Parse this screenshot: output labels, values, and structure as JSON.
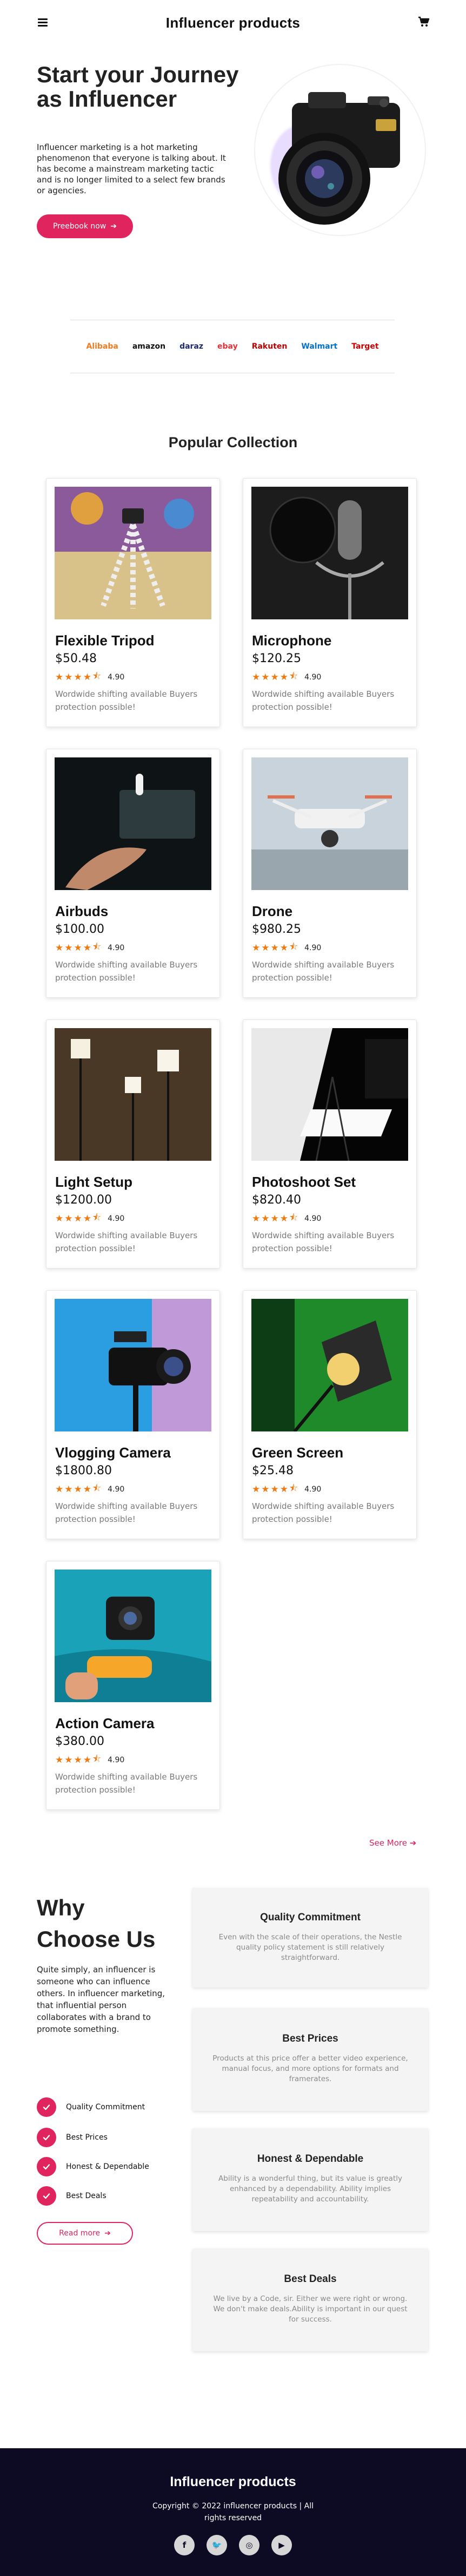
{
  "header": {
    "title": "Influencer products"
  },
  "hero": {
    "title": "Start your Journey as Influencer",
    "text": "Influencer marketing is a hot marketing phenomenon that everyone is talking about. It has become a mainstream marketing tactic and is no longer limited to a select few brands or agencies.",
    "button_label": "Preebook now"
  },
  "brands": [
    {
      "name": "Alibaba",
      "color": "#f47a20"
    },
    {
      "name": "amazon",
      "color": "#111111"
    },
    {
      "name": "daraz",
      "color": "#1a2a6c"
    },
    {
      "name": "ebay",
      "color": "#e53238"
    },
    {
      "name": "Rakuten",
      "color": "#bf0000"
    },
    {
      "name": "Walmart",
      "color": "#0071ce"
    },
    {
      "name": "Target",
      "color": "#cc0000"
    }
  ],
  "products_section": {
    "title": "Popular Collection",
    "see_more_label": "See More"
  },
  "products": [
    {
      "name": "Flexible Tripod",
      "price": "$50.48",
      "rating": "4.90",
      "desc": "Wordwide shifting available Buyers protection possible!"
    },
    {
      "name": "Microphone",
      "price": "$120.25",
      "rating": "4.90",
      "desc": "Wordwide shifting available Buyers protection possible!"
    },
    {
      "name": "Airbuds",
      "price": "$100.00",
      "rating": "4.90",
      "desc": "Wordwide shifting available Buyers protection possible!"
    },
    {
      "name": "Drone",
      "price": "$980.25",
      "rating": "4.90",
      "desc": "Wordwide shifting available Buyers protection possible!"
    },
    {
      "name": "Light Setup",
      "price": "$1200.00",
      "rating": "4.90",
      "desc": "Wordwide shifting available Buyers protection possible!"
    },
    {
      "name": "Photoshoot Set",
      "price": "$820.40",
      "rating": "4.90",
      "desc": "Wordwide shifting available Buyers protection possible!"
    },
    {
      "name": "Vlogging Camera",
      "price": "$1800.80",
      "rating": "4.90",
      "desc": "Wordwide shifting available Buyers protection possible!"
    },
    {
      "name": "Green Screen",
      "price": "$25.48",
      "rating": "4.90",
      "desc": "Wordwide shifting available Buyers protection possible!"
    },
    {
      "name": "Action Camera",
      "price": "$380.00",
      "rating": "4.90",
      "desc": "Wordwide shifting available Buyers protection possible!"
    }
  ],
  "why": {
    "title": "Why Choose Us",
    "text": "Quite simply, an influencer is someone who can influence others. In influencer marketing, that influential person collaborates with a brand to promote something.",
    "checks": [
      "Quality Commitment",
      "Best Prices",
      "Honest & Dependable",
      "Best Deals"
    ],
    "read_more_label": "Read more",
    "features": [
      {
        "title": "Quality Commitment",
        "text": "Even with the scale of their operations, the Nestle quality policy statement is still relatively straightforward."
      },
      {
        "title": "Best Prices",
        "text": "Products at this price offer a better video experience, manual focus, and more options for formats and framerates."
      },
      {
        "title": "Honest & Dependable",
        "text": "Ability is a wonderful thing, but its value is greatly enhanced by a dependability. Ability implies repeatability and accountability."
      },
      {
        "title": "Best Deals",
        "text": "We live by a Code, sir. Either we were right or wrong. We don't make deals.Ability is important in our quest for success."
      }
    ]
  },
  "footer": {
    "title": "Influencer products",
    "copyright": "Copyright © 2022 influencer products | All rights reserved",
    "socials": [
      "facebook-icon",
      "twitter-icon",
      "instagram-icon",
      "youtube-icon"
    ]
  },
  "colors": {
    "accent": "#e0245e",
    "star": "#ef7a10",
    "footer_bg": "#0d0b24"
  }
}
